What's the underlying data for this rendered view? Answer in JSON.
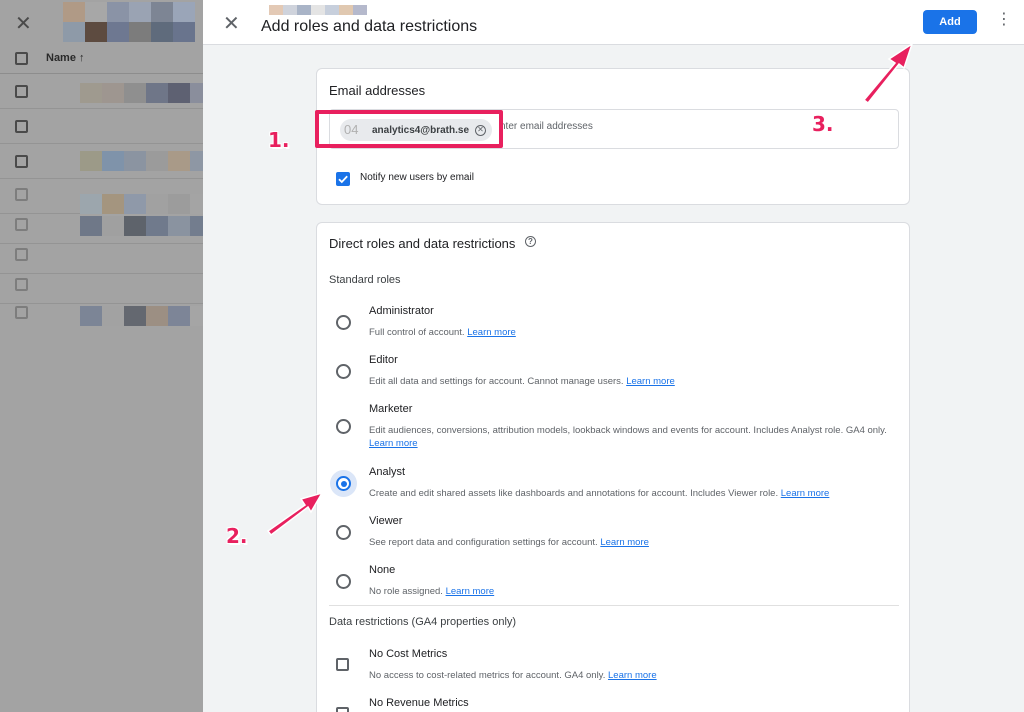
{
  "panel": {
    "title": "Add roles and data restrictions",
    "add_label": "Add"
  },
  "background_list": {
    "name_header": "Name ↑"
  },
  "email_card": {
    "title": "Email addresses",
    "chip_avatar": "04",
    "chip_email": "analytics4@brath.se",
    "input_placeholder": "nter email addresses",
    "notify_label": "Notify new users by email",
    "notify_checked": true
  },
  "roles_card": {
    "title": "Direct roles and data restrictions",
    "standard_roles_label": "Standard roles",
    "roles": [
      {
        "name": "Administrator",
        "desc": "Full control of account.",
        "learn": "Learn more",
        "selected": false
      },
      {
        "name": "Editor",
        "desc": "Edit all data and settings for account. Cannot manage users.",
        "learn": "Learn more",
        "selected": false
      },
      {
        "name": "Marketer",
        "desc": "Edit audiences, conversions, attribution models, lookback windows and events for account. Includes Analyst role. GA4 only.",
        "learn": "Learn more",
        "selected": false
      },
      {
        "name": "Analyst",
        "desc": "Create and edit shared assets like dashboards and annotations for account. Includes Viewer role.",
        "learn": "Learn more",
        "selected": true
      },
      {
        "name": "Viewer",
        "desc": "See report data and configuration settings for account.",
        "learn": "Learn more",
        "selected": false
      },
      {
        "name": "None",
        "desc": "No role assigned.",
        "learn": "Learn more",
        "selected": false
      }
    ],
    "data_restrictions_label": "Data restrictions (GA4 properties only)",
    "restrictions": [
      {
        "name": "No Cost Metrics",
        "desc": "No access to cost-related metrics for account. GA4 only.",
        "learn": "Learn more",
        "checked": false
      },
      {
        "name": "No Revenue Metrics",
        "desc": "",
        "learn": "",
        "checked": false
      }
    ]
  },
  "annotations": {
    "step1": "1.",
    "step2": "2.",
    "step3": "3.",
    "color": "#e8205e"
  },
  "icons": {
    "close": "close-icon",
    "more": "more-vert-icon",
    "help": "help-icon",
    "chip_remove": "cancel-circle-icon",
    "check": "check-icon"
  }
}
